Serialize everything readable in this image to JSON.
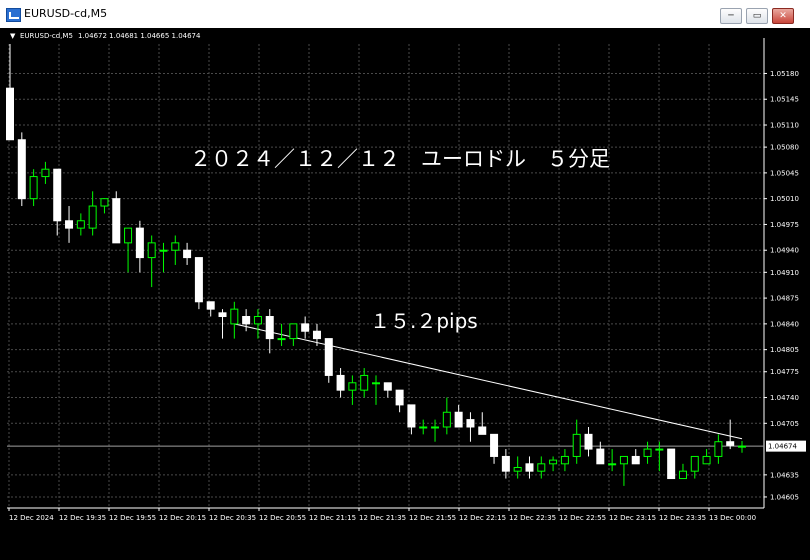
{
  "window": {
    "title": "EURUSD-cd,M5",
    "buttons": {
      "minimize": "─",
      "restore": "▭",
      "close": "✕"
    }
  },
  "chart_header": {
    "marker": "▼",
    "symbol": "EURUSD-cd,M5",
    "ohlc": "1.04672 1.04681 1.04665 1.04674"
  },
  "annotations": {
    "title": "２０２４／１２／１２　ユーロドル　５分足",
    "pips": "１５.２pips"
  },
  "current_price": "1.04674",
  "colors": {
    "background": "#000000",
    "bull": "#00ff00",
    "bear": "#ffffff",
    "grid": "#4a4a4a",
    "text": "#ffffff"
  },
  "chart_data": {
    "type": "candlestick",
    "symbol": "EURUSD-cd",
    "timeframe": "M5",
    "ylim": [
      1.0459,
      1.0522
    ],
    "yticks": [
      "1.05180",
      "1.05145",
      "1.05110",
      "1.05080",
      "1.05045",
      "1.05010",
      "1.04975",
      "1.04940",
      "1.04910",
      "1.04875",
      "1.04840",
      "1.04805",
      "1.04775",
      "1.04740",
      "1.04705",
      "1.04635",
      "1.04605"
    ],
    "xticks": [
      "12 Dec 2024",
      "12 Dec 19:35",
      "12 Dec 19:55",
      "12 Dec 20:15",
      "12 Dec 20:35",
      "12 Dec 20:55",
      "12 Dec 21:15",
      "12 Dec 21:35",
      "12 Dec 21:55",
      "12 Dec 22:15",
      "12 Dec 22:35",
      "12 Dec 22:55",
      "12 Dec 23:15",
      "12 Dec 23:35",
      "13 Dec 00:00"
    ],
    "grid": true,
    "trendline": {
      "from": 1.0484,
      "to": 1.04684
    },
    "candles": [
      {
        "o": 1.0516,
        "h": 1.0522,
        "l": 1.0509,
        "c": 1.0509
      },
      {
        "o": 1.0509,
        "h": 1.051,
        "l": 1.05,
        "c": 1.0501
      },
      {
        "o": 1.0501,
        "h": 1.0505,
        "l": 1.05,
        "c": 1.0504
      },
      {
        "o": 1.0504,
        "h": 1.0506,
        "l": 1.0503,
        "c": 1.0505
      },
      {
        "o": 1.0505,
        "h": 1.0505,
        "l": 1.0496,
        "c": 1.0498
      },
      {
        "o": 1.0498,
        "h": 1.05,
        "l": 1.0495,
        "c": 1.0497
      },
      {
        "o": 1.0497,
        "h": 1.0499,
        "l": 1.0496,
        "c": 1.0498
      },
      {
        "o": 1.0497,
        "h": 1.0502,
        "l": 1.0496,
        "c": 1.05
      },
      {
        "o": 1.05,
        "h": 1.0501,
        "l": 1.0499,
        "c": 1.0501
      },
      {
        "o": 1.0501,
        "h": 1.0502,
        "l": 1.0495,
        "c": 1.0495
      },
      {
        "o": 1.0495,
        "h": 1.0497,
        "l": 1.0491,
        "c": 1.0497
      },
      {
        "o": 1.0497,
        "h": 1.0498,
        "l": 1.0491,
        "c": 1.0493
      },
      {
        "o": 1.0493,
        "h": 1.0496,
        "l": 1.0489,
        "c": 1.0495
      },
      {
        "o": 1.0494,
        "h": 1.0495,
        "l": 1.0491,
        "c": 1.0494
      },
      {
        "o": 1.0494,
        "h": 1.0496,
        "l": 1.0492,
        "c": 1.0495
      },
      {
        "o": 1.0494,
        "h": 1.0495,
        "l": 1.0492,
        "c": 1.0493
      },
      {
        "o": 1.0493,
        "h": 1.0493,
        "l": 1.0486,
        "c": 1.0487
      },
      {
        "o": 1.0487,
        "h": 1.0487,
        "l": 1.0485,
        "c": 1.0486
      },
      {
        "o": 1.04855,
        "h": 1.0486,
        "l": 1.0482,
        "c": 1.0485
      },
      {
        "o": 1.0484,
        "h": 1.0487,
        "l": 1.0482,
        "c": 1.0486
      },
      {
        "o": 1.0485,
        "h": 1.0486,
        "l": 1.0483,
        "c": 1.0484
      },
      {
        "o": 1.0484,
        "h": 1.0486,
        "l": 1.0482,
        "c": 1.0485
      },
      {
        "o": 1.0485,
        "h": 1.0486,
        "l": 1.048,
        "c": 1.0482
      },
      {
        "o": 1.0482,
        "h": 1.0484,
        "l": 1.0481,
        "c": 1.0482
      },
      {
        "o": 1.0482,
        "h": 1.0484,
        "l": 1.0481,
        "c": 1.0484
      },
      {
        "o": 1.0484,
        "h": 1.0485,
        "l": 1.0482,
        "c": 1.0483
      },
      {
        "o": 1.0483,
        "h": 1.0484,
        "l": 1.0481,
        "c": 1.0482
      },
      {
        "o": 1.0482,
        "h": 1.0482,
        "l": 1.0476,
        "c": 1.0477
      },
      {
        "o": 1.0477,
        "h": 1.0478,
        "l": 1.0474,
        "c": 1.0475
      },
      {
        "o": 1.0475,
        "h": 1.0477,
        "l": 1.0473,
        "c": 1.0476
      },
      {
        "o": 1.0475,
        "h": 1.0478,
        "l": 1.0474,
        "c": 1.0477
      },
      {
        "o": 1.0476,
        "h": 1.0477,
        "l": 1.0473,
        "c": 1.0476
      },
      {
        "o": 1.0476,
        "h": 1.0476,
        "l": 1.0474,
        "c": 1.0475
      },
      {
        "o": 1.0475,
        "h": 1.0475,
        "l": 1.0472,
        "c": 1.0473
      },
      {
        "o": 1.0473,
        "h": 1.0473,
        "l": 1.0469,
        "c": 1.047
      },
      {
        "o": 1.047,
        "h": 1.0471,
        "l": 1.0469,
        "c": 1.047
      },
      {
        "o": 1.047,
        "h": 1.0471,
        "l": 1.0468,
        "c": 1.047
      },
      {
        "o": 1.047,
        "h": 1.0474,
        "l": 1.0469,
        "c": 1.0472
      },
      {
        "o": 1.0472,
        "h": 1.0473,
        "l": 1.047,
        "c": 1.047
      },
      {
        "o": 1.0471,
        "h": 1.0472,
        "l": 1.0468,
        "c": 1.047
      },
      {
        "o": 1.047,
        "h": 1.0472,
        "l": 1.0469,
        "c": 1.0469
      },
      {
        "o": 1.0469,
        "h": 1.0469,
        "l": 1.0465,
        "c": 1.0466
      },
      {
        "o": 1.0466,
        "h": 1.0467,
        "l": 1.0463,
        "c": 1.0464
      },
      {
        "o": 1.0464,
        "h": 1.0466,
        "l": 1.0463,
        "c": 1.04645
      },
      {
        "o": 1.0465,
        "h": 1.0466,
        "l": 1.0463,
        "c": 1.0464
      },
      {
        "o": 1.0464,
        "h": 1.0466,
        "l": 1.0463,
        "c": 1.0465
      },
      {
        "o": 1.0465,
        "h": 1.0466,
        "l": 1.0464,
        "c": 1.04655
      },
      {
        "o": 1.0465,
        "h": 1.0467,
        "l": 1.0464,
        "c": 1.0466
      },
      {
        "o": 1.0466,
        "h": 1.0471,
        "l": 1.0465,
        "c": 1.0469
      },
      {
        "o": 1.0469,
        "h": 1.047,
        "l": 1.0466,
        "c": 1.0467
      },
      {
        "o": 1.0467,
        "h": 1.0468,
        "l": 1.0465,
        "c": 1.0465
      },
      {
        "o": 1.0465,
        "h": 1.0467,
        "l": 1.0464,
        "c": 1.0465
      },
      {
        "o": 1.0465,
        "h": 1.0466,
        "l": 1.0462,
        "c": 1.0466
      },
      {
        "o": 1.0466,
        "h": 1.0467,
        "l": 1.0465,
        "c": 1.0465
      },
      {
        "o": 1.0466,
        "h": 1.0468,
        "l": 1.0465,
        "c": 1.0467
      },
      {
        "o": 1.0467,
        "h": 1.0468,
        "l": 1.0464,
        "c": 1.0467
      },
      {
        "o": 1.0467,
        "h": 1.0467,
        "l": 1.0463,
        "c": 1.0463
      },
      {
        "o": 1.0463,
        "h": 1.0465,
        "l": 1.0463,
        "c": 1.0464
      },
      {
        "o": 1.0464,
        "h": 1.0466,
        "l": 1.0463,
        "c": 1.0466
      },
      {
        "o": 1.0465,
        "h": 1.0467,
        "l": 1.0465,
        "c": 1.0466
      },
      {
        "o": 1.0466,
        "h": 1.0469,
        "l": 1.0465,
        "c": 1.0468
      },
      {
        "o": 1.0468,
        "h": 1.0471,
        "l": 1.0467,
        "c": 1.04675
      },
      {
        "o": 1.04674,
        "h": 1.04681,
        "l": 1.04665,
        "c": 1.04674
      }
    ]
  }
}
